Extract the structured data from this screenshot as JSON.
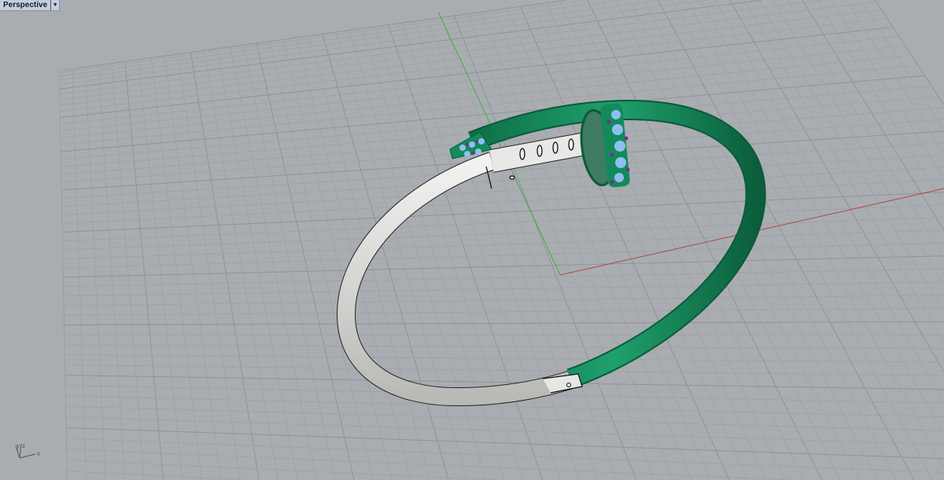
{
  "viewport": {
    "title": "Perspective",
    "dropdown_icon": "chevron-down-icon",
    "axis_labels": {
      "x": "x",
      "y": "y",
      "z": "z"
    }
  },
  "colors": {
    "background": "#a9adb2",
    "grid_minor": "#9da1a6",
    "grid_major": "#8f9399",
    "x_axis": "#b84040",
    "y_axis": "#3fae3f",
    "green_metal": "#138a5a",
    "silver_metal": "#e2e2e0",
    "gem_blue": "#8fbff0",
    "gem_purple": "#7a2a9a"
  }
}
